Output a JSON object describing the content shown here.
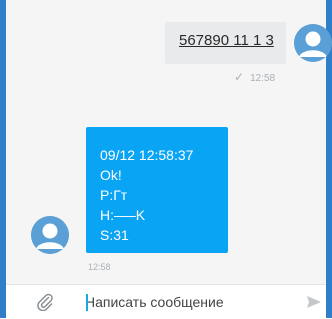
{
  "outgoing_message": {
    "text": "567890 11 1 3",
    "time": "12:58",
    "status_icon": "check-icon"
  },
  "incoming_message": {
    "lines": [
      "09/12 12:58:37",
      "Ok!",
      "P:Гт",
      "H:—–K",
      "S:31"
    ],
    "time": "12:58"
  },
  "composer": {
    "placeholder": "Написать сообщение",
    "attach_icon": "paperclip-icon",
    "send_icon": "send-icon"
  },
  "colors": {
    "accent_border": "#2f7ec7",
    "incoming_bubble": "#09a4f3",
    "outgoing_bubble": "#e9eaeb",
    "avatar": "#5aa0d6"
  }
}
